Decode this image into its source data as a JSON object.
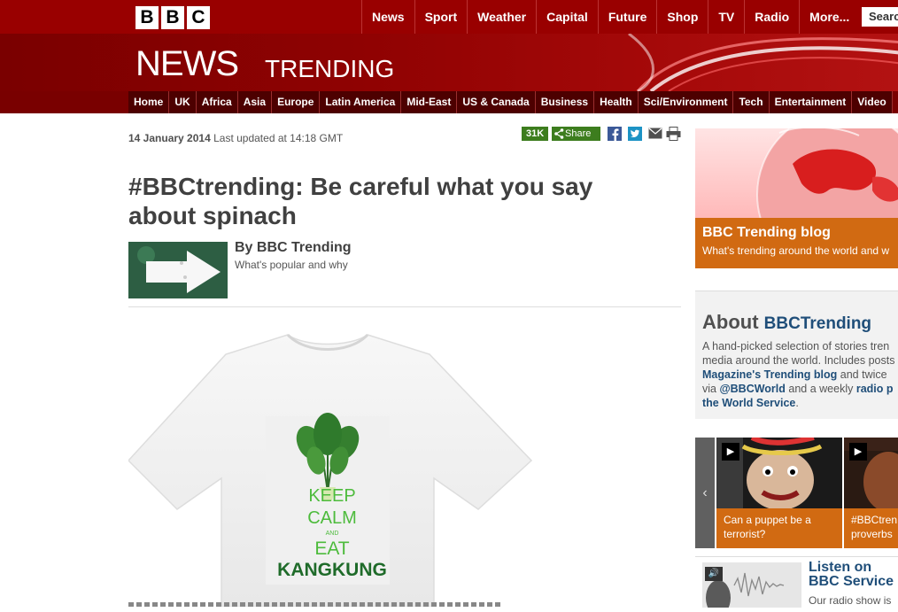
{
  "header": {
    "logo_letters": [
      "B",
      "B",
      "C"
    ],
    "global_nav": [
      "News",
      "Sport",
      "Weather",
      "Capital",
      "Future",
      "Shop",
      "TV",
      "Radio",
      "More..."
    ],
    "search_label": "Search",
    "news_word": "NEWS",
    "trending_word": "TRENDING"
  },
  "section_nav": [
    "Home",
    "UK",
    "Africa",
    "Asia",
    "Europe",
    "Latin America",
    "Mid-East",
    "US & Canada",
    "Business",
    "Health",
    "Sci/Environment",
    "Tech",
    "Entertainment",
    "Video"
  ],
  "article": {
    "date": "14 January 2014",
    "updated": "Last updated at 14:18 GMT",
    "share_count": "31K",
    "share_label": "Share",
    "headline": "#BBCtrending: Be careful what you say about spinach",
    "byline_name": "By BBC Trending",
    "byline_role": "What's popular and why",
    "image_text": [
      "KEEP",
      "CALM",
      "AND",
      "EAT",
      "KANGKUNG"
    ]
  },
  "sidebar": {
    "blog_title": "BBC Trending blog",
    "blog_desc": "What's trending around the world and w",
    "about_word": "About",
    "about_brand": "BBCTrending",
    "about_lines": [
      [
        "A hand-picked selection of stories tren",
        ""
      ],
      [
        "media around the world. Includes posts",
        ""
      ],
      [
        "",
        "Magazine's Trending blog",
        " and twice"
      ],
      [
        "via ",
        "@BBCWorld",
        " and a weekly ",
        "radio p"
      ],
      [
        "",
        "the World Service",
        "."
      ]
    ],
    "video_captions": [
      "Can a puppet be a terrorist?",
      "#BBCtren proverbs"
    ],
    "listen_title": "Listen on BBC Service",
    "listen_desc": "Our radio show is"
  },
  "colors": {
    "brand_red": "#990000",
    "orange": "#d16a12",
    "link_blue": "#1f4e79",
    "share_green": "#3d7d1e"
  }
}
